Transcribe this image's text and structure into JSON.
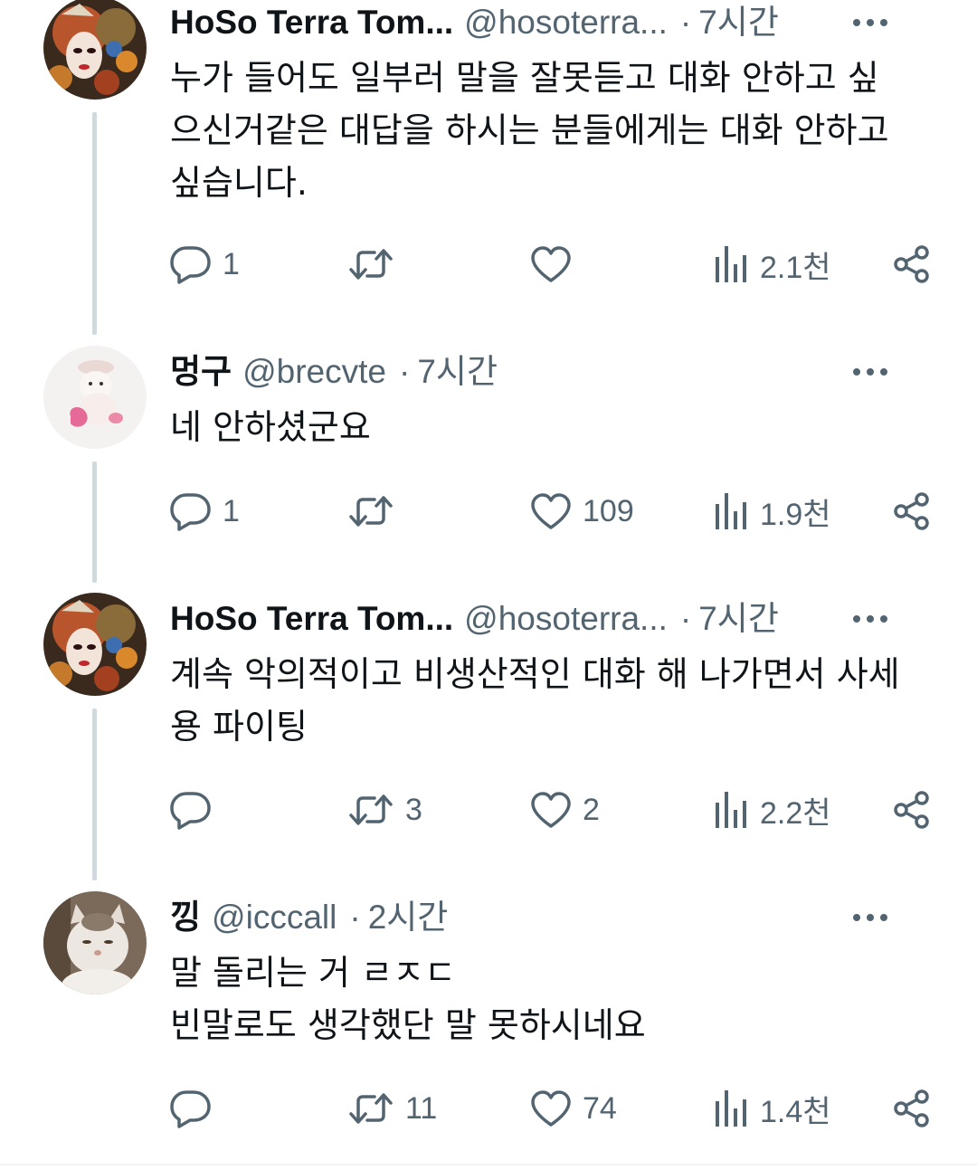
{
  "tweets": [
    {
      "name": "HoSo Terra Tom...",
      "handle": "@hosoterra...",
      "separator": "·",
      "time": "7시간",
      "text": "누가 들어도 일부러 말을 잘못듣고 대화 안하고 싶\n으신거같은 대답을 하시는 분들에게는 대화 안하고\n싶습니다.",
      "replies": "1",
      "retweets": "",
      "likes": "",
      "views": "2.1천"
    },
    {
      "name": "멍구",
      "handle": "@brecvte",
      "separator": "·",
      "time": "7시간",
      "text": "네 안하셨군요",
      "replies": "1",
      "retweets": "",
      "likes": "109",
      "views": "1.9천"
    },
    {
      "name": "HoSo Terra Tom...",
      "handle": "@hosoterra...",
      "separator": "·",
      "time": "7시간",
      "text": "계속 악의적이고 비생산적인 대화 해 나가면서 사세\n용 파이팅",
      "replies": "",
      "retweets": "3",
      "likes": "2",
      "views": "2.2천"
    },
    {
      "name": "낑",
      "handle": "@icccall",
      "separator": "·",
      "time": "2시간",
      "text": "말 돌리는 거 ㄹㅈㄷ\n빈말로도 생각했단 말 못하시네요",
      "replies": "",
      "retweets": "11",
      "likes": "74",
      "views": "1.4천"
    }
  ],
  "icons": {
    "more": "more-dots-icon",
    "reply": "reply-bubble-icon",
    "retweet": "retweet-arrows-icon",
    "like": "heart-icon",
    "views": "bar-chart-icon",
    "share": "share-icon"
  },
  "colors": {
    "text": "#0f1419",
    "muted": "#536471",
    "thread_line": "#cfd9de"
  }
}
